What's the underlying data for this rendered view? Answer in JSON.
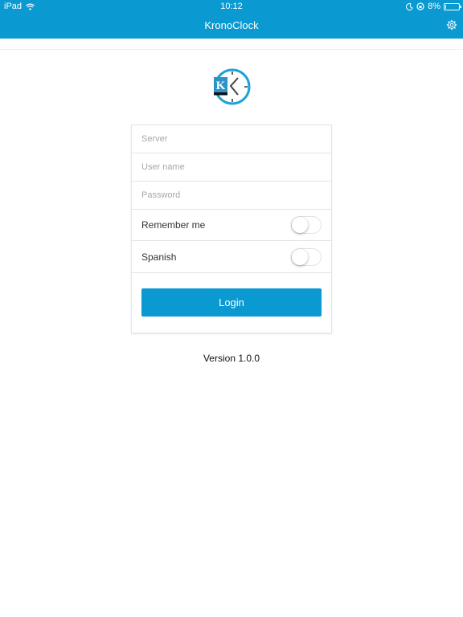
{
  "status_bar": {
    "device": "iPad",
    "time": "10:12",
    "battery_percent": "8%"
  },
  "navbar": {
    "title": "KronoClock",
    "settings_icon": "gear-icon"
  },
  "logo": {
    "letter": "K",
    "icon": "clock-logo-icon"
  },
  "form": {
    "server_placeholder": "Server",
    "server_value": "",
    "username_placeholder": "User name",
    "username_value": "",
    "password_placeholder": "Password",
    "password_value": "",
    "remember_label": "Remember me",
    "remember_on": false,
    "spanish_label": "Spanish",
    "spanish_on": false,
    "login_label": "Login"
  },
  "version": "Version 1.0.0",
  "colors": {
    "primary": "#0a99d0",
    "logo_ring": "#1ba3d6",
    "logo_k_bg": "#2a93c8"
  }
}
